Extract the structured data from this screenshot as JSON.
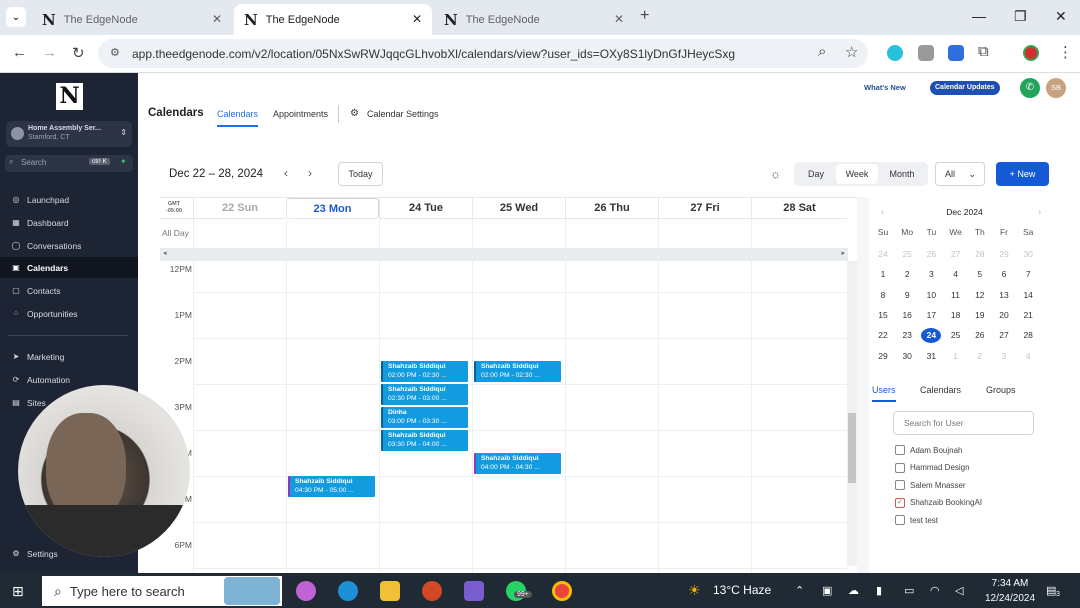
{
  "browser": {
    "tabs": [
      {
        "title": "The EdgeNode"
      },
      {
        "title": "The EdgeNode"
      },
      {
        "title": "The EdgeNode"
      }
    ],
    "tab_logo": "N",
    "url": "app.theedgenode.com/v2/location/05NxSwRWJqqcGLhvobXl/calendars/view?user_ids=OXy8S1lyDnGfJHeycSxg"
  },
  "sidebar": {
    "logo": "N",
    "location_name": "Home Assembly Ser...",
    "location_city": "Stamford, CT",
    "search_placeholder": "Search",
    "search_shortcut": "ctrl K",
    "items": [
      {
        "label": "Launchpad",
        "icon": "rocket-icon"
      },
      {
        "label": "Dashboard",
        "icon": "dashboard-icon"
      },
      {
        "label": "Conversations",
        "icon": "chat-icon"
      },
      {
        "label": "Calendars",
        "icon": "calendar-icon",
        "active": true
      },
      {
        "label": "Contacts",
        "icon": "contacts-icon"
      },
      {
        "label": "Opportunities",
        "icon": "opportunities-icon"
      },
      {
        "label": "Marketing",
        "icon": "send-icon"
      },
      {
        "label": "Automation",
        "icon": "automation-icon"
      },
      {
        "label": "Sites",
        "icon": "sites-icon"
      }
    ],
    "settings_label": "Settings"
  },
  "header": {
    "title": "Calendars",
    "tabs": [
      "Calendars",
      "Appointments",
      "Calendar Settings"
    ],
    "whats_new": "What's New",
    "calendar_updates": "Calendar Updates",
    "avatar_initials": "SB"
  },
  "toolbar": {
    "date_range": "Dec 22 – 28, 2024",
    "today_label": "Today",
    "views": [
      "Day",
      "Week",
      "Month"
    ],
    "filter_value": "All",
    "new_label": "+ New"
  },
  "week": {
    "gmt_label_1": "GMT",
    "gmt_label_2": "-05:00",
    "all_day_label": "All Day",
    "days": [
      "22 Sun",
      "23 Mon",
      "24 Tue",
      "25 Wed",
      "26 Thu",
      "27 Fri",
      "28 Sat"
    ],
    "times": [
      "12PM",
      "1PM",
      "2PM",
      "3PM",
      "4PM",
      "5PM",
      "6PM"
    ],
    "events": [
      {
        "name": "Shahzaib Siddiqui",
        "time": "02:00 PM - 02:30 ...",
        "day": 2,
        "start_hour": 14.0,
        "purple": false
      },
      {
        "name": "Shahzaib Siddiqui",
        "time": "02:30 PM - 03:00 ...",
        "day": 2,
        "start_hour": 14.5,
        "purple": false
      },
      {
        "name": "Dinha",
        "time": "03:00 PM - 03:30 ...",
        "day": 2,
        "start_hour": 15.0,
        "purple": false
      },
      {
        "name": "Shahzaib Siddiqui",
        "time": "03:30 PM - 04:00 ...",
        "day": 2,
        "start_hour": 15.5,
        "purple": false
      },
      {
        "name": "Shahzaib Siddiqui",
        "time": "02:00 PM - 02:30 ...",
        "day": 3,
        "start_hour": 14.0,
        "purple": false
      },
      {
        "name": "Shahzaib Siddiqui",
        "time": "04:00 PM - 04:30 ...",
        "day": 3,
        "start_hour": 16.0,
        "purple": true
      },
      {
        "name": "Shahzaib Siddiqui",
        "time": "04:30 PM - 05:00 ...",
        "day": 1,
        "start_hour": 16.5,
        "purple": true
      }
    ]
  },
  "mini_calendar": {
    "title": "Dec 2024",
    "weekdays": [
      "Su",
      "Mo",
      "Tu",
      "We",
      "Th",
      "Fr",
      "Sa"
    ],
    "weeks": [
      [
        {
          "d": "24",
          "m": true
        },
        {
          "d": "25",
          "m": true
        },
        {
          "d": "26",
          "m": true
        },
        {
          "d": "27",
          "m": true
        },
        {
          "d": "28",
          "m": true
        },
        {
          "d": "29",
          "m": true
        },
        {
          "d": "30",
          "m": true
        }
      ],
      [
        {
          "d": "1"
        },
        {
          "d": "2"
        },
        {
          "d": "3"
        },
        {
          "d": "4"
        },
        {
          "d": "5"
        },
        {
          "d": "6"
        },
        {
          "d": "7"
        }
      ],
      [
        {
          "d": "8"
        },
        {
          "d": "9"
        },
        {
          "d": "10"
        },
        {
          "d": "11"
        },
        {
          "d": "12"
        },
        {
          "d": "13"
        },
        {
          "d": "14"
        }
      ],
      [
        {
          "d": "15"
        },
        {
          "d": "16"
        },
        {
          "d": "17"
        },
        {
          "d": "18"
        },
        {
          "d": "19"
        },
        {
          "d": "20"
        },
        {
          "d": "21"
        }
      ],
      [
        {
          "d": "22"
        },
        {
          "d": "23"
        },
        {
          "d": "24",
          "sel": true
        },
        {
          "d": "25"
        },
        {
          "d": "26"
        },
        {
          "d": "27"
        },
        {
          "d": "28"
        }
      ],
      [
        {
          "d": "29"
        },
        {
          "d": "30"
        },
        {
          "d": "31"
        },
        {
          "d": "1",
          "m": true
        },
        {
          "d": "2",
          "m": true
        },
        {
          "d": "3",
          "m": true
        },
        {
          "d": "4",
          "m": true
        }
      ]
    ]
  },
  "users_panel": {
    "tabs": [
      "Users",
      "Calendars",
      "Groups"
    ],
    "search_placeholder": "Search for User",
    "users": [
      {
        "name": "Adam Boujnah",
        "checked": false
      },
      {
        "name": "Hammad Design",
        "checked": false
      },
      {
        "name": "Salem Mnasser",
        "checked": false
      },
      {
        "name": "Shahzaib BookingAI",
        "checked": true
      },
      {
        "name": "test test",
        "checked": false
      }
    ]
  },
  "taskbar": {
    "search_placeholder": "Type here to search",
    "weather": "13°C  Haze",
    "time": "7:34 AM",
    "date": "12/24/2024",
    "whatsapp_badge": "99+",
    "notif_count": "3"
  }
}
